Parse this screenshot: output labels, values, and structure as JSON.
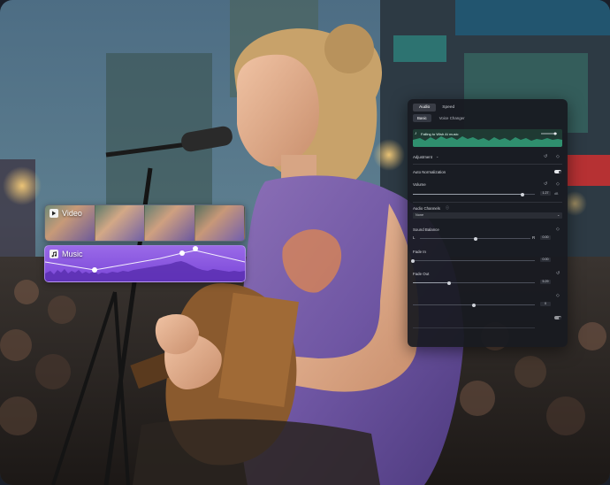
{
  "timeline": {
    "video_track": {
      "label": "Video",
      "icon": "play-icon"
    },
    "music_track": {
      "label": "Music",
      "icon": "music-note-icon"
    }
  },
  "audio_panel": {
    "tabs": [
      {
        "label": "Audio",
        "active": true
      },
      {
        "label": "Speed",
        "active": false
      }
    ],
    "subtabs": [
      {
        "label": "Basic",
        "active": true
      },
      {
        "label": "Voice Changer",
        "active": false
      }
    ],
    "clip": {
      "name": "Falling to Wish AI music",
      "icon": "audio-clip-icon"
    },
    "adjustment": {
      "label": "Adjustment"
    },
    "auto_normalization": {
      "label": "Auto Normalization",
      "enabled": true
    },
    "volume": {
      "label": "Volume",
      "value": "1.27",
      "unit": "dB",
      "level": 0.9
    },
    "audio_channels": {
      "label": "Audio Channels",
      "selected": "None"
    },
    "sound_balance": {
      "label": "Sound Balance",
      "left_label": "L",
      "right_label": "R",
      "value": "0.00",
      "level": 0.5
    },
    "fade_in": {
      "label": "Fade In",
      "value": "0.00"
    },
    "fade_out": {
      "label": "Fade Out",
      "value": "5.29",
      "level": 0.3
    },
    "pitch": {
      "value": "0",
      "level": 0.5
    }
  },
  "colors": {
    "music_track": "#8a58e0",
    "waveform_clip": "#2f8f6e",
    "panel_bg": "#181a20"
  }
}
